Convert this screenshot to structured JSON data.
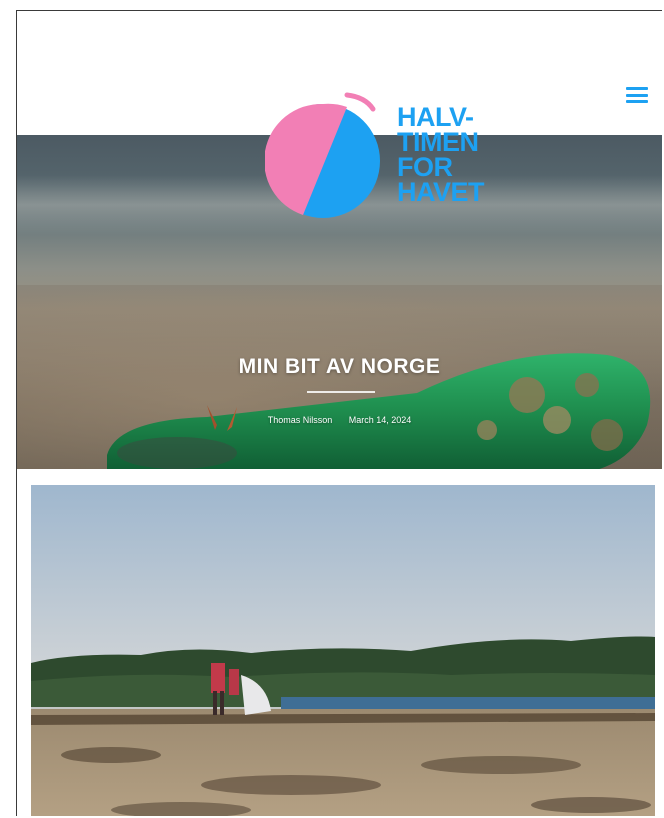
{
  "logo": {
    "line1": "HALV-",
    "line2": "TIMEN",
    "line3": "FOR",
    "line4": "HAVET",
    "circle_pink": "#f27fb5",
    "circle_blue": "#1da1f2"
  },
  "header": {
    "menu_icon": "hamburger-menu-icon"
  },
  "post": {
    "title": "MIN BIT AV NORGE",
    "author": "Thomas Nilsson",
    "date": "March 14, 2024"
  },
  "colors": {
    "brand_blue": "#1da1f2",
    "brand_pink": "#f27fb5"
  }
}
